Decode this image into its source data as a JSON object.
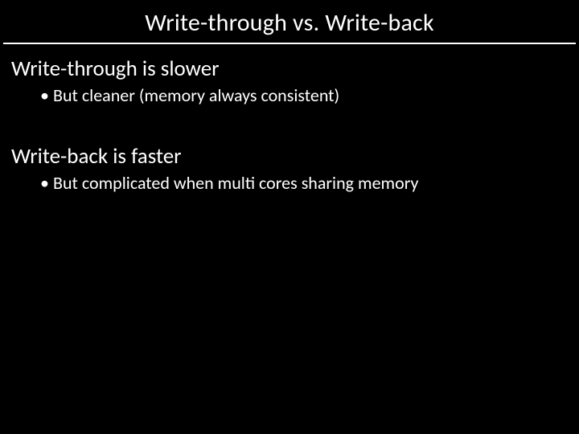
{
  "title": "Write-through vs. Write-back",
  "section1": {
    "heading": "Write-through is slower",
    "bullet": "But cleaner (memory always consistent)"
  },
  "section2": {
    "heading": "Write-back is faster",
    "bullet": "But complicated when multi cores sharing memory"
  }
}
